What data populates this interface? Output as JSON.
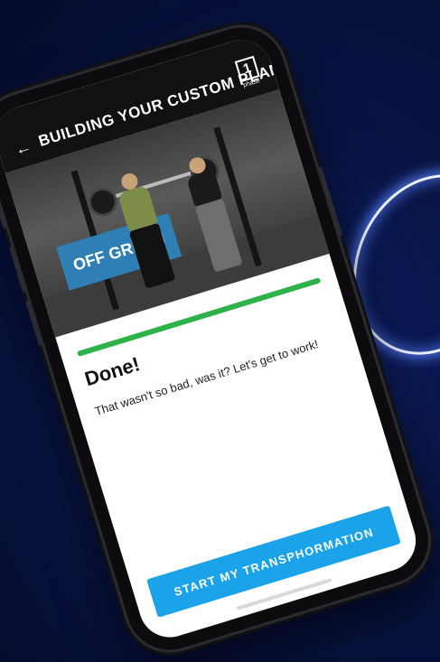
{
  "header": {
    "back_icon": "arrow-left-icon",
    "title": "BUILDING YOUR CUSTOM PLAN",
    "logo_text": "1",
    "logo_subtext": "phase"
  },
  "hero": {
    "banner_text": "OFF GREEN"
  },
  "progress": {
    "value": 1.0,
    "color": "#2db24a"
  },
  "content": {
    "heading": "Done!",
    "message": "That wasn't so bad, was it? Let's get to work!"
  },
  "cta": {
    "label": "START MY TRANSPHORMATION",
    "color": "#1aa3e8"
  }
}
